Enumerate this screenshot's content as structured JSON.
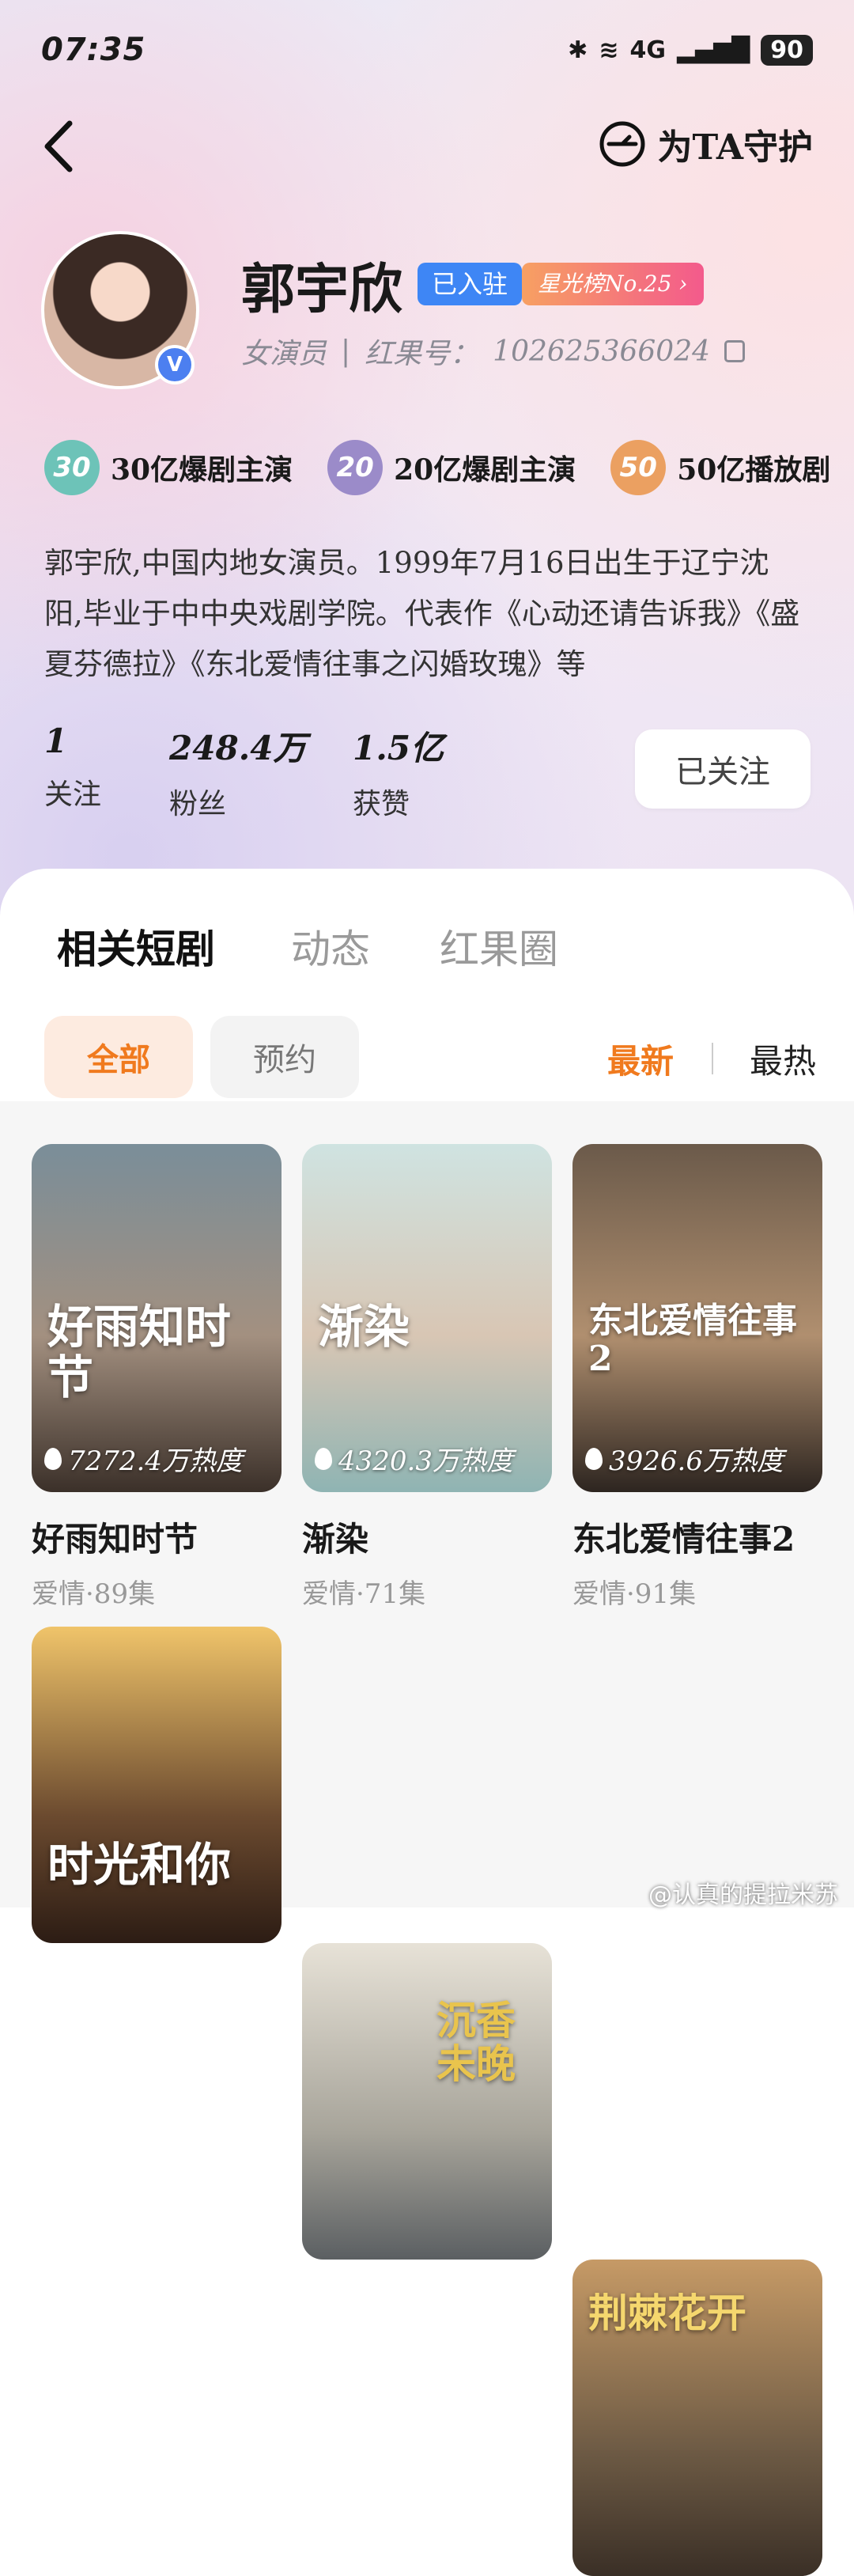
{
  "status": {
    "time": "07:35",
    "network": "4G",
    "signal_icon": "signal-bars-icon",
    "battery": "90"
  },
  "nav": {
    "guard_label": "为TA守护"
  },
  "profile": {
    "name": "郭宇欣",
    "joined_badge": "已入驻",
    "rank_badge": "星光榜No.25",
    "role": "女演员",
    "id_label": "红果号：",
    "id_value": "102625366024"
  },
  "achievements": [
    {
      "num": "30",
      "label": "30亿爆剧主演",
      "color": "#6dc3b8"
    },
    {
      "num": "20",
      "label": "20亿爆剧主演",
      "color": "#9b8bc9"
    },
    {
      "num": "50",
      "label": "50亿播放剧",
      "color": "#eba061"
    }
  ],
  "bio": "郭宇欣,中国内地女演员。1999年7月16日出生于辽宁沈阳,毕业于中中央戏剧学院。代表作《心动还请告诉我》《盛夏芬德拉》《东北爱情往事之闪婚玫瑰》等",
  "stats": [
    {
      "value": "1",
      "label": "关注"
    },
    {
      "value": "248.4万",
      "label": "粉丝"
    },
    {
      "value": "1.5亿",
      "label": "获赞"
    }
  ],
  "follow_button": "已关注",
  "tabs": [
    "相关短剧",
    "动态",
    "红果圈"
  ],
  "filters": [
    "全部",
    "预约"
  ],
  "sort": [
    "最新",
    "最热"
  ],
  "dramas": [
    {
      "title": "好雨知时节",
      "poster_text": "好雨知时节",
      "heat": "7272.4万热度",
      "meta": "爱情·89集",
      "colors": [
        "#7a8e99",
        "#a39080",
        "#3b3029"
      ]
    },
    {
      "title": "渐染",
      "poster_text": "渐染",
      "heat": "4320.3万热度",
      "meta": "爱情·71集",
      "colors": [
        "#cfe3e1",
        "#d8c6b4",
        "#8fb4b3"
      ]
    },
    {
      "title": "东北爱情往事2",
      "poster_text": "东北爱情往事2",
      "heat": "3926.6万热度",
      "meta": "爱情·91集",
      "colors": [
        "#6b5a4a",
        "#b08f6f",
        "#2d2520"
      ]
    }
  ],
  "dramas_row2": [
    {
      "poster_text": "时光和你",
      "colors": [
        "#f0c46a",
        "#6b4a2f",
        "#2c1c14"
      ]
    },
    {
      "poster_text": "沉香未晚",
      "colors": [
        "#e7e2d7",
        "#a7a49a",
        "#5b5f62"
      ]
    },
    {
      "poster_text": "荆棘花开",
      "colors": [
        "#c69a66",
        "#6e5b45",
        "#3a2f26"
      ]
    }
  ],
  "watermark": "@认真的提拉米苏"
}
